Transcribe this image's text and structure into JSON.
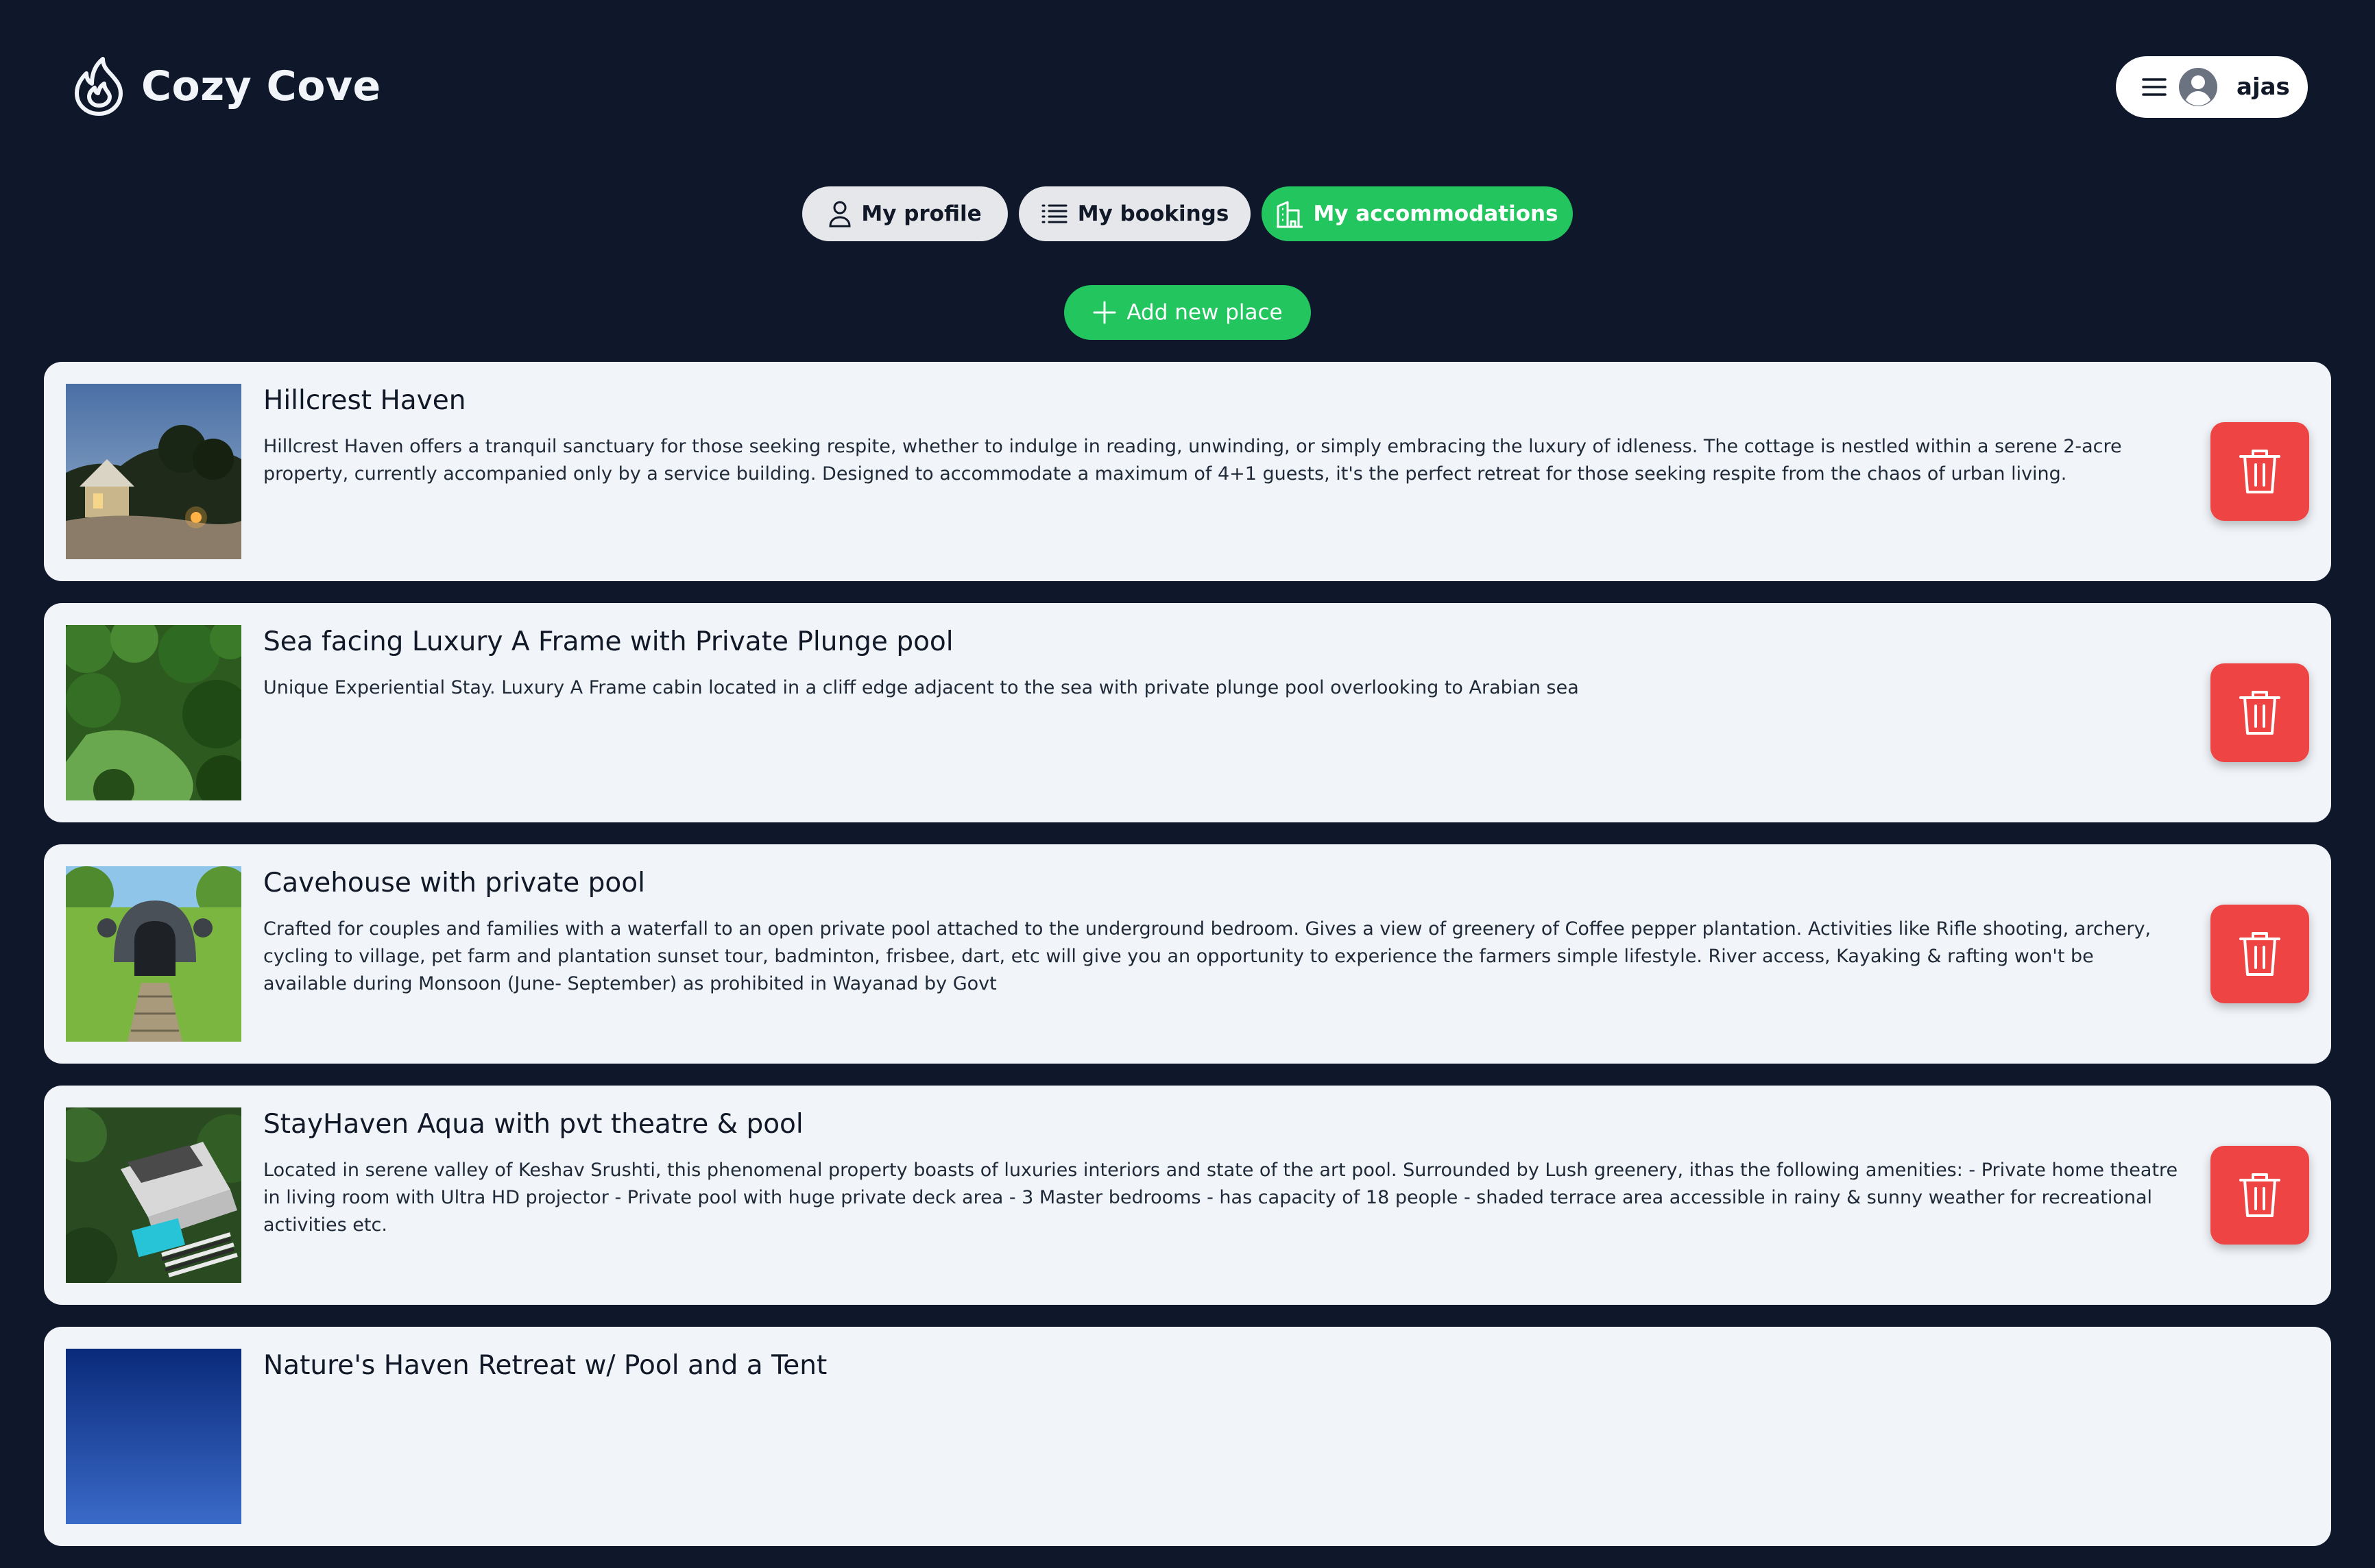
{
  "app": {
    "name": "Cozy Cove",
    "logo_icon": "flame-icon"
  },
  "user_menu": {
    "menu_icon": "hamburger-icon",
    "avatar_icon": "user-circle-icon",
    "username": "ajas"
  },
  "tabs": [
    {
      "label": "My profile",
      "icon": "user-icon",
      "active": false
    },
    {
      "label": "My bookings",
      "icon": "list-icon",
      "active": false
    },
    {
      "label": "My accommodations",
      "icon": "building-icon",
      "active": true
    }
  ],
  "add_button": {
    "label": "Add new place",
    "icon": "plus-icon"
  },
  "places": [
    {
      "title": "Hillcrest Haven",
      "description": "Hillcrest Haven offers a tranquil sanctuary for those seeking respite, whether to indulge in reading, unwinding, or simply embracing the luxury of idleness. The cottage is nestled within a serene 2-acre property, currently accompanied only by a service building. Designed to accommodate a maximum of 4+1 guests, it's the perfect retreat for those seeking respite from the chaos of urban living."
    },
    {
      "title": "Sea facing Luxury A Frame with Private Plunge pool",
      "description": "Unique Experiential Stay. Luxury A Frame cabin located in a cliff edge adjacent to the sea with private plunge pool overlooking to Arabian sea"
    },
    {
      "title": "Cavehouse with private pool",
      "description": "Crafted for couples and families with a waterfall to an open private pool attached to the underground bedroom. Gives a view of greenery of Coffee pepper plantation. Activities like Rifle shooting, archery, cycling to village, pet farm and plantation sunset tour, badminton, frisbee, dart, etc will give you an opportunity to experience the farmers simple lifestyle. River access, Kayaking & rafting won't be available during Monsoon (June- September) as prohibited in Wayanad by Govt"
    },
    {
      "title": "StayHaven Aqua with pvt theatre & pool",
      "description": "Located in serene valley of Keshav Srushti, this phenomenal property boasts of luxuries interiors and state of the art pool. Surrounded by Lush greenery, ithas the following amenities: - Private home theatre in living room with Ultra HD projector - Private pool with huge private deck area - 3 Master bedrooms - has capacity of 18 people - shaded terrace area accessible in rainy & sunny weather for recreational activities etc."
    },
    {
      "title": "Nature's Haven Retreat w/ Pool and a Tent",
      "description": ""
    }
  ],
  "delete_icon": "trash-icon",
  "colors": {
    "background": "#0f172a",
    "accent": "#22c55e",
    "danger": "#ef4444",
    "card": "#f1f5f9"
  }
}
